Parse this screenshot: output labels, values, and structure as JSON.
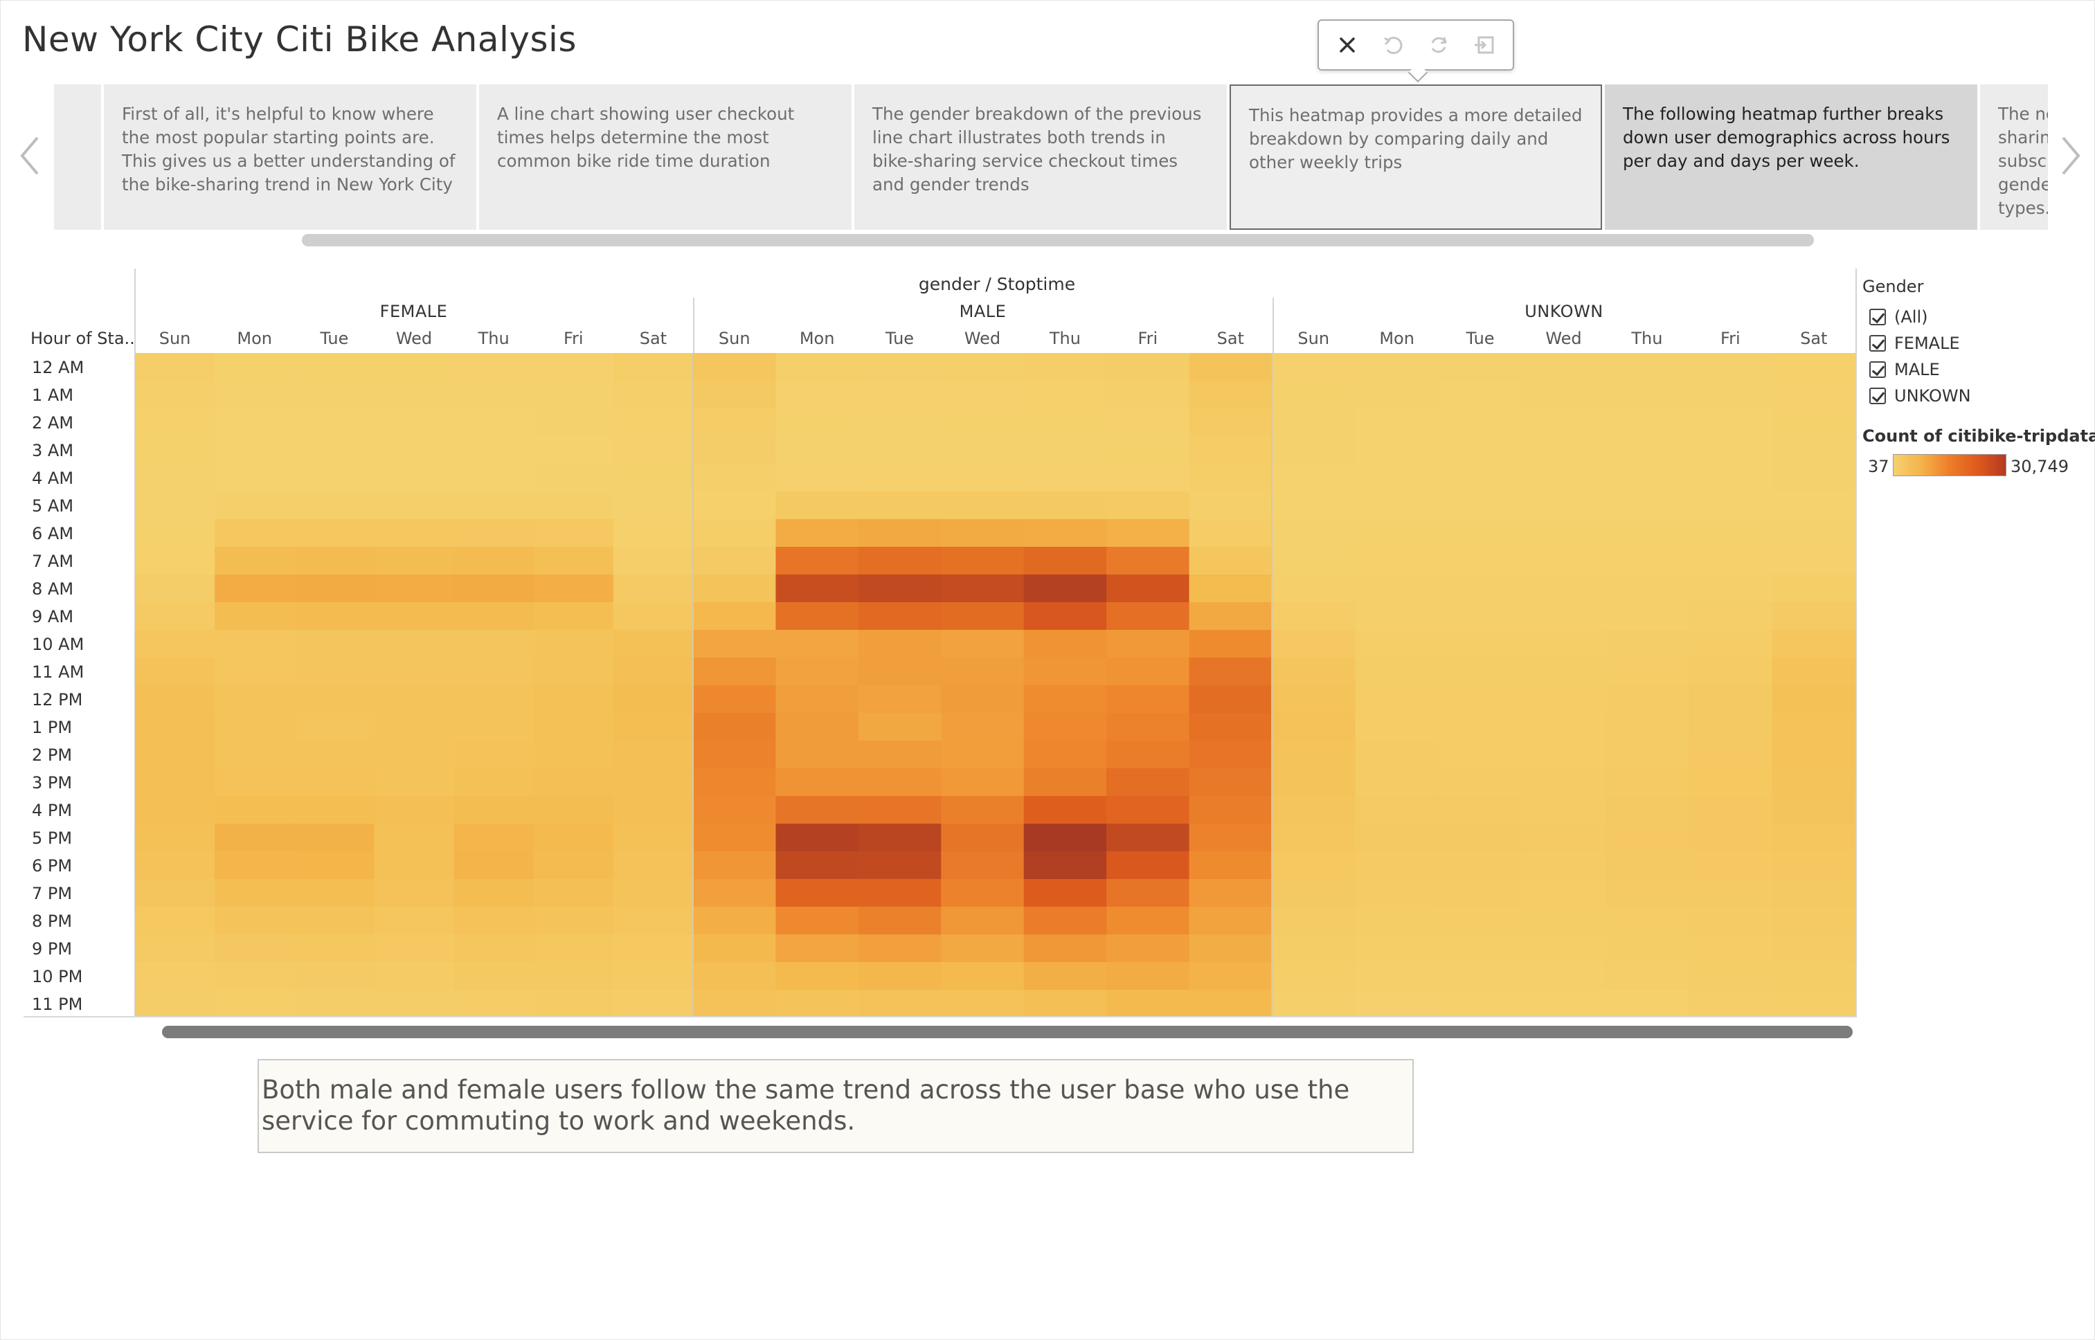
{
  "dashboard": {
    "title": "New York City Citi Bike Analysis"
  },
  "story_toolbar": {
    "buttons": [
      "close-icon",
      "undo-icon",
      "revert-icon",
      "revert-to-story-icon"
    ]
  },
  "story_points": [
    {
      "text": ""
    },
    {
      "text": "First of all, it's helpful to know where  the most popular starting points are. This gives us a better understanding of the bike-sharing trend in New York City"
    },
    {
      "text": "A line chart showing user checkout times helps determine the most common bike ride time duration"
    },
    {
      "text": "The gender breakdown of the previous line chart illustrates both trends in bike-sharing service checkout times and gender trends"
    },
    {
      "text": "This heatmap provides a more detailed breakdown by comparing daily and other weekly trips"
    },
    {
      "text": "The following heatmap further breaks down user demographics across hours per day and days per week."
    },
    {
      "text": "The ne sharin subscr gende types."
    }
  ],
  "legend": {
    "filter_title": "Gender",
    "filter_items": [
      "(All)",
      "FEMALE",
      "MALE",
      "UNKOWN"
    ],
    "color_title": "Count of citibike-tripdata..",
    "color_min": "37",
    "color_max": "30,749"
  },
  "caption": "Both male and female users follow the same trend across the user base who use the service for commuting to work and weekends.",
  "chart_data": {
    "type": "heatmap",
    "title": "gender / Stoptime",
    "row_header": "Hour of Sta..",
    "columns_group_label": "gender / Stoptime",
    "groups": [
      "FEMALE",
      "MALE",
      "UNKOWN"
    ],
    "days": [
      "Sun",
      "Mon",
      "Tue",
      "Wed",
      "Thu",
      "Fri",
      "Sat"
    ],
    "hours": [
      "12 AM",
      "1 AM",
      "2 AM",
      "3 AM",
      "4 AM",
      "5 AM",
      "6 AM",
      "7 AM",
      "8 AM",
      "9 AM",
      "10 AM",
      "11 AM",
      "12 PM",
      "1 PM",
      "2 PM",
      "3 PM",
      "4 PM",
      "5 PM",
      "6 PM",
      "7 PM",
      "8 PM",
      "9 PM",
      "10 PM",
      "11 PM"
    ],
    "color_range": [
      37,
      30749
    ],
    "colors": [
      "#f5d26e",
      "#f4b94c",
      "#ef8a2f",
      "#dd5b1d",
      "#a83a23"
    ],
    "values": {
      "FEMALE": [
        [
          1200,
          400,
          400,
          450,
          500,
          500,
          1300
        ],
        [
          900,
          200,
          200,
          250,
          250,
          300,
          1100
        ],
        [
          650,
          150,
          120,
          150,
          150,
          200,
          800
        ],
        [
          450,
          120,
          100,
          120,
          120,
          150,
          600
        ],
        [
          300,
          150,
          150,
          150,
          150,
          200,
          450
        ],
        [
          250,
          900,
          1000,
          1000,
          950,
          850,
          350
        ],
        [
          450,
          3400,
          3500,
          3400,
          3300,
          3000,
          700
        ],
        [
          800,
          6500,
          6800,
          6600,
          6800,
          6000,
          1200
        ],
        [
          1500,
          9800,
          10200,
          10000,
          10200,
          9300,
          2400
        ],
        [
          2600,
          6600,
          6800,
          6700,
          6800,
          6200,
          3500
        ],
        [
          3800,
          3700,
          4000,
          3900,
          4000,
          4400,
          5200
        ],
        [
          5000,
          3800,
          4000,
          3900,
          4000,
          4600,
          6000
        ],
        [
          5600,
          4300,
          4300,
          4400,
          4600,
          5200,
          6500
        ],
        [
          5900,
          4300,
          3900,
          4300,
          4600,
          5300,
          6300
        ],
        [
          5800,
          4400,
          4400,
          4300,
          4800,
          5300,
          6000
        ],
        [
          5600,
          4800,
          4900,
          4700,
          5300,
          5800,
          5900
        ],
        [
          5600,
          6100,
          6200,
          5900,
          6500,
          6500,
          5800
        ],
        [
          5300,
          8800,
          8900,
          5200,
          8300,
          7300,
          5300
        ],
        [
          4800,
          8200,
          8400,
          5400,
          8500,
          6700,
          4900
        ],
        [
          4100,
          6100,
          6300,
          4900,
          6500,
          5500,
          4300
        ],
        [
          3200,
          4500,
          4700,
          3800,
          4900,
          4300,
          3600
        ],
        [
          2500,
          3300,
          3500,
          3000,
          3700,
          3500,
          3100
        ],
        [
          2000,
          2200,
          2400,
          2200,
          2700,
          2900,
          2600
        ],
        [
          1500,
          1300,
          1500,
          1500,
          1800,
          2200,
          2000
        ]
      ],
      "MALE": [
        [
          3600,
          1100,
          1000,
          1100,
          1300,
          1600,
          4300
        ],
        [
          2700,
          600,
          500,
          600,
          700,
          900,
          3400
        ],
        [
          2000,
          400,
          350,
          400,
          450,
          600,
          2600
        ],
        [
          1500,
          300,
          300,
          300,
          350,
          450,
          2000
        ],
        [
          1000,
          500,
          500,
          500,
          500,
          550,
          1400
        ],
        [
          800,
          2800,
          2900,
          2900,
          2800,
          2600,
          1000
        ],
        [
          1300,
          10000,
          10300,
          10100,
          10000,
          9000,
          2000
        ],
        [
          2400,
          19000,
          20000,
          19500,
          20800,
          18000,
          3600
        ],
        [
          4500,
          26000,
          27000,
          26500,
          29000,
          24800,
          7000
        ],
        [
          7800,
          19500,
          20800,
          20300,
          24000,
          19800,
          10300
        ],
        [
          11000,
          11000,
          12000,
          11500,
          14000,
          13000,
          15300
        ],
        [
          13500,
          11500,
          12000,
          12000,
          13500,
          14000,
          18800
        ],
        [
          15800,
          12000,
          11500,
          12500,
          15000,
          16000,
          20200
        ],
        [
          17000,
          12500,
          10500,
          12000,
          15500,
          16500,
          19500
        ],
        [
          16600,
          12500,
          12500,
          12200,
          16000,
          17500,
          19000
        ],
        [
          16000,
          14000,
          14000,
          13000,
          17000,
          20000,
          18200
        ],
        [
          15500,
          18800,
          19000,
          17000,
          22500,
          21500,
          17500
        ],
        [
          15000,
          29000,
          28300,
          18800,
          30749,
          27000,
          16700
        ],
        [
          13500,
          27200,
          27000,
          18000,
          29500,
          23800,
          15300
        ],
        [
          11800,
          21600,
          21600,
          16500,
          22900,
          18800,
          13000
        ],
        [
          9500,
          15500,
          16800,
          13200,
          17600,
          15000,
          11300
        ],
        [
          7600,
          11000,
          11800,
          10300,
          13300,
          12000,
          9700
        ],
        [
          6000,
          7300,
          8000,
          7300,
          9500,
          10000,
          8700
        ],
        [
          4800,
          4300,
          4800,
          4800,
          5800,
          7500,
          7400
        ]
      ],
      "UNKOWN": [
        [
          600,
          300,
          300,
          300,
          300,
          350,
          700
        ],
        [
          450,
          200,
          180,
          200,
          200,
          250,
          500
        ],
        [
          350,
          150,
          120,
          150,
          150,
          180,
          400
        ],
        [
          250,
          100,
          90,
          100,
          100,
          130,
          300
        ],
        [
          150,
          80,
          80,
          80,
          80,
          100,
          200
        ],
        [
          100,
          150,
          150,
          150,
          150,
          150,
          150
        ],
        [
          200,
          400,
          400,
          400,
          400,
          400,
          300
        ],
        [
          400,
          700,
          700,
          700,
          700,
          700,
          600
        ],
        [
          900,
          1000,
          1000,
          1000,
          1000,
          1000,
          1300
        ],
        [
          1800,
          1100,
          1100,
          1100,
          1100,
          1200,
          2400
        ],
        [
          3000,
          1400,
          1400,
          1400,
          1500,
          1800,
          3800
        ],
        [
          4000,
          1700,
          1700,
          1700,
          1800,
          2300,
          4800
        ],
        [
          4600,
          1900,
          1900,
          1900,
          2100,
          2700,
          5200
        ],
        [
          4800,
          2000,
          2000,
          2000,
          2200,
          2900,
          5100
        ],
        [
          4700,
          2100,
          2000,
          2000,
          2300,
          3000,
          4800
        ],
        [
          4500,
          2200,
          2200,
          2100,
          2500,
          3200,
          4500
        ],
        [
          4100,
          2500,
          2400,
          2300,
          2800,
          3300,
          4200
        ],
        [
          3700,
          2800,
          2700,
          2400,
          3000,
          3300,
          3700
        ],
        [
          3200,
          2600,
          2600,
          2300,
          2900,
          3000,
          3300
        ],
        [
          2700,
          2200,
          2200,
          2000,
          2500,
          2600,
          2900
        ],
        [
          2100,
          1700,
          1800,
          1600,
          2000,
          2200,
          2500
        ],
        [
          1700,
          1300,
          1400,
          1300,
          1600,
          1900,
          2100
        ],
        [
          1300,
          1000,
          1000,
          1000,
          1200,
          1600,
          1700
        ],
        [
          900,
          600,
          700,
          700,
          800,
          1200,
          1400
        ]
      ]
    }
  }
}
